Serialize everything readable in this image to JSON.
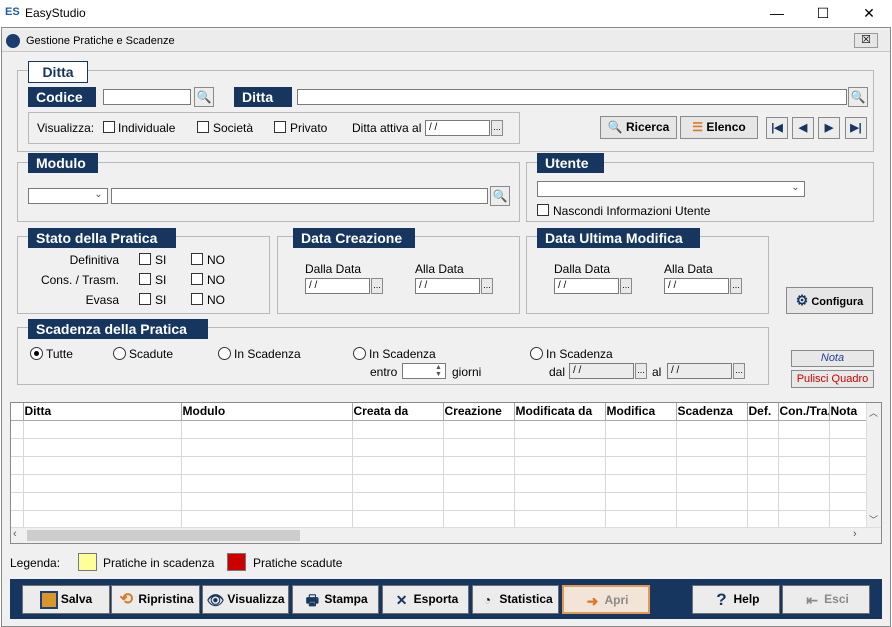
{
  "window": {
    "app_title": "EasyStudio",
    "minimize": "—",
    "maximize": "☐",
    "close": "✕",
    "logo": "ES"
  },
  "child": {
    "title": "Gestione Pratiche e Scadenze",
    "close": "☒"
  },
  "ditta": {
    "group_title": "Ditta",
    "codice_label": "Codice",
    "codice_value": "",
    "ditta_label": "Ditta",
    "ditta_value": "",
    "visualizza_label": "Visualizza:",
    "individuale": "Individuale",
    "societa": "Società",
    "privato": "Privato",
    "attiva_label": "Ditta attiva al",
    "attiva_value": " / /",
    "dots": "..."
  },
  "toolbar": {
    "ricerca": "Ricerca",
    "elenco": "Elenco",
    "first": "|◀",
    "prev": "◀",
    "next": "▶",
    "last": "▶|"
  },
  "modulo": {
    "title": "Modulo",
    "combo_value": "",
    "text_value": ""
  },
  "utente": {
    "title": "Utente",
    "combo_value": "",
    "nascondi": "Nascondi Informazioni Utente"
  },
  "stato": {
    "title": "Stato della Pratica",
    "rows": [
      "Definitiva",
      "Cons. / Trasm.",
      "Evasa"
    ],
    "si": "SI",
    "no": "NO"
  },
  "data_creazione": {
    "title": "Data Creazione",
    "dalla": "Dalla Data",
    "alla": "Alla Data",
    "dalla_value": " / /",
    "alla_value": " / /"
  },
  "data_modifica": {
    "title": "Data Ultima Modifica",
    "dalla": "Dalla Data",
    "alla": "Alla Data",
    "dalla_value": " / /",
    "alla_value": " / /"
  },
  "configura": "Configura",
  "scadenza": {
    "title": "Scadenza della Pratica",
    "tutte": "Tutte",
    "scadute": "Scadute",
    "in_scadenza": "In Scadenza",
    "in_scadenza2": "In Scadenza",
    "in_scadenza3": "In Scadenza",
    "entro": "entro",
    "giorni": "giorni",
    "dal": "dal",
    "al": "al",
    "dal_value": " / /",
    "al_value": " / /",
    "entro_value": ""
  },
  "side": {
    "nota": "Nota",
    "pulisci": "Pulisci Quadro"
  },
  "grid": {
    "columns": [
      "Ditta",
      "Modulo",
      "Creata da",
      "Creazione",
      "Modificata da",
      "Modifica",
      "Scadenza",
      "Def.",
      "Con./Tra.",
      "Nota"
    ]
  },
  "legenda": {
    "label": "Legenda:",
    "in_scadenza": "Pratiche in scadenza",
    "scadute": "Pratiche scadute",
    "color_in_scadenza": "#ffff99",
    "color_scadute": "#cc0000"
  },
  "buttons": {
    "salva": "Salva",
    "ripristina": "Ripristina",
    "visualizza": "Visualizza",
    "stampa": "Stampa",
    "esporta": "Esporta",
    "statistica": "Statistica",
    "apri": "Apri",
    "help": "Help",
    "esci": "Esci"
  }
}
